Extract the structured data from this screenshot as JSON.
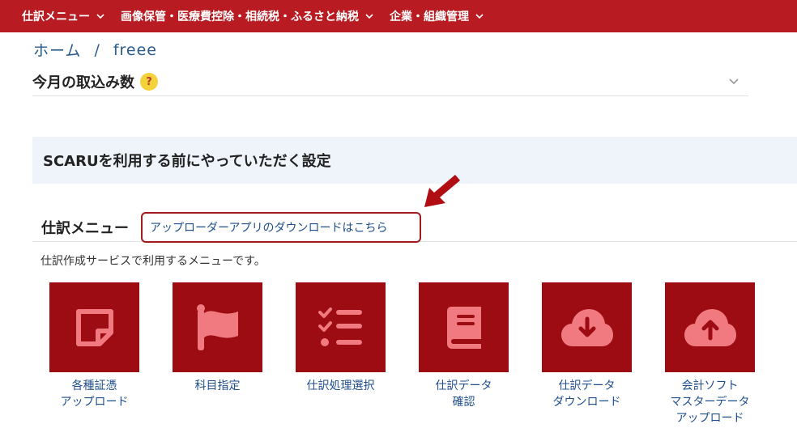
{
  "nav": {
    "items": [
      {
        "label": "仕訳メニュー"
      },
      {
        "label": "画像保管・医療費控除・相続税・ふるさと納税"
      },
      {
        "label": "企業・組織管理"
      }
    ]
  },
  "breadcrumb": {
    "home": "ホーム",
    "separator": "/",
    "current": "freee"
  },
  "monthly": {
    "title": "今月の取込み数",
    "help": "?"
  },
  "setup": {
    "text": "SCARUを利用する前にやっていただく設定"
  },
  "journal_menu": {
    "title": "仕訳メニュー",
    "download_link": "アップローダーアプリのダウンロードはこちら",
    "description": "仕訳作成サービスで利用するメニューです。"
  },
  "tiles": [
    {
      "label": "各種証憑\nアップロード",
      "icon": "note-icon"
    },
    {
      "label": "科目指定",
      "icon": "flag-icon"
    },
    {
      "label": "仕訳処理選択",
      "icon": "checklist-icon"
    },
    {
      "label": "仕訳データ\n確認",
      "icon": "book-icon"
    },
    {
      "label": "仕訳データ\nダウンロード",
      "icon": "cloud-download-icon"
    },
    {
      "label": "会計ソフト\nマスターデータ\nアップロード",
      "icon": "cloud-upload-icon"
    }
  ],
  "colors": {
    "header_bg": "#b81c22",
    "tile_bg": "#9c0c12",
    "tile_icon": "#f07a80",
    "link": "#1f4e8c",
    "banner_bg": "#eef4fa",
    "callout_border": "#a01a1e",
    "arrow": "#b00e12"
  }
}
